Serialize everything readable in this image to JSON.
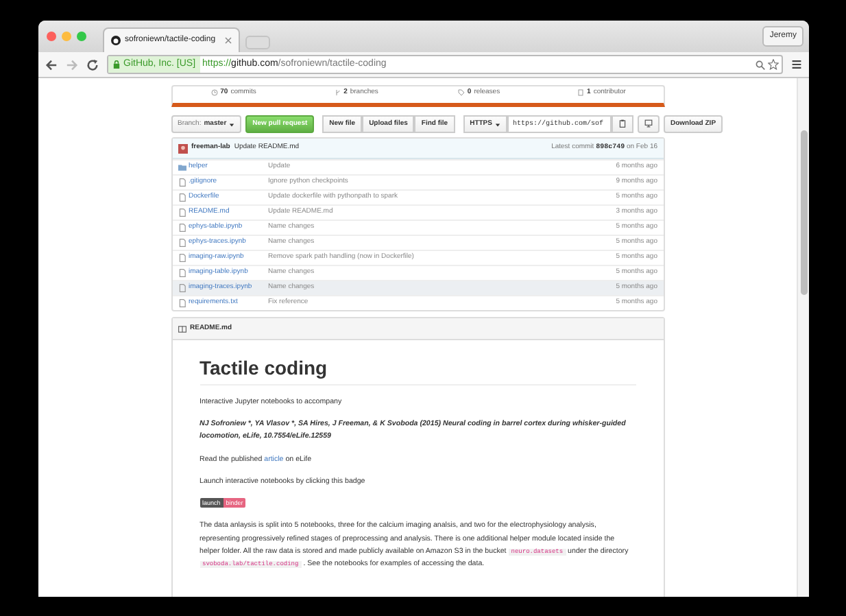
{
  "browser": {
    "tab_title": "sofroniewn/tactile-coding",
    "user": "Jeremy",
    "ev_badge": "GitHub, Inc. [US]",
    "url_scheme": "https://",
    "url_host": "github.com",
    "url_path": "/sofroniewn/tactile-coding"
  },
  "stats": [
    {
      "kind": "commits",
      "count": "70",
      "label": "commits"
    },
    {
      "kind": "branches",
      "count": "2",
      "label": "branches"
    },
    {
      "kind": "releases",
      "count": "0",
      "label": "releases"
    },
    {
      "kind": "contributors",
      "count": "1",
      "label": "contributor"
    }
  ],
  "toolbar": {
    "branch_label": "Branch:",
    "branch": "master",
    "pull_request": "New pull request",
    "file_buttons": [
      "New file",
      "Upload files",
      "Find file"
    ],
    "protocol": "HTTPS",
    "clone_url": "https://github.com/sof",
    "download": "Download ZIP"
  },
  "latest_commit": {
    "author": "freeman-lab",
    "message": "Update README.md",
    "prefix": "Latest commit",
    "sha": "898c749",
    "date": "on Feb 16"
  },
  "files": [
    {
      "kind": "dir",
      "name": "helper",
      "message": "Update",
      "age": "6 months ago",
      "highlighted": false
    },
    {
      "kind": "file",
      "name": ".gitignore",
      "message": "Ignore python checkpoints",
      "age": "9 months ago",
      "highlighted": false
    },
    {
      "kind": "file",
      "name": "Dockerfile",
      "message": "Update dockerfile with pythonpath to spark",
      "age": "5 months ago",
      "highlighted": false
    },
    {
      "kind": "file",
      "name": "README.md",
      "message": "Update README.md",
      "age": "3 months ago",
      "highlighted": false
    },
    {
      "kind": "file",
      "name": "ephys-table.ipynb",
      "message": "Name changes",
      "age": "5 months ago",
      "highlighted": false
    },
    {
      "kind": "file",
      "name": "ephys-traces.ipynb",
      "message": "Name changes",
      "age": "5 months ago",
      "highlighted": false
    },
    {
      "kind": "file",
      "name": "imaging-raw.ipynb",
      "message": "Remove spark path handling (now in Dockerfile)",
      "age": "5 months ago",
      "highlighted": false
    },
    {
      "kind": "file",
      "name": "imaging-table.ipynb",
      "message": "Name changes",
      "age": "5 months ago",
      "highlighted": false
    },
    {
      "kind": "file",
      "name": "imaging-traces.ipynb",
      "message": "Name changes",
      "age": "5 months ago",
      "highlighted": true
    },
    {
      "kind": "file",
      "name": "requirements.txt",
      "message": "Fix reference",
      "age": "5 months ago",
      "highlighted": false
    }
  ],
  "readme": {
    "filename": "README.md",
    "title": "Tactile coding",
    "intro": "Interactive Jupyter notebooks to accompany",
    "citation": "NJ Sofroniew *, YA Vlasov *, SA Hires, J Freeman, & K Svoboda (2015) Neural coding in barrel cortex during whisker-guided locomotion, eLife, 10.7554/eLife.12559",
    "read_line": [
      {
        "kind": "text",
        "text": "Read the published "
      },
      {
        "kind": "link",
        "text": "article"
      },
      {
        "kind": "text",
        "text": " on eLife"
      }
    ],
    "launch_line": "Launch interactive notebooks by clicking this badge",
    "badge": {
      "left": "launch",
      "right": "binder"
    },
    "paragraph": [
      {
        "kind": "text",
        "text": "The data anlaysis is split into 5 notebooks, three for the calcium imaging analsis, and two for the electrophysiology analysis, representing progressively refined stages of preprocessing and analysis. There is one additional helper module located inside the helper folder. All the raw data is stored and made publicly available on Amazon S3 in the bucket "
      },
      {
        "kind": "code",
        "text": "neuro.datasets"
      },
      {
        "kind": "text",
        "text": " under the directory "
      },
      {
        "kind": "code",
        "text": "svoboda.lab/tactile.coding"
      },
      {
        "kind": "text",
        "text": " . See the notebooks for examples of accessing the data."
      }
    ]
  }
}
